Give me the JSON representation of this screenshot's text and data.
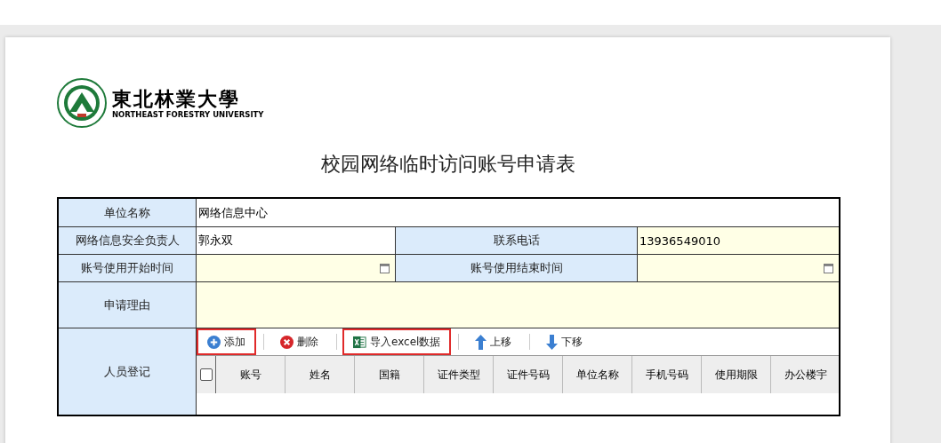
{
  "logo": {
    "name_cn": "東北林業大學",
    "name_en": "NORTHEAST FORESTRY UNIVERSITY"
  },
  "title": "校园网络临时访问账号申请表",
  "form": {
    "unit": {
      "label": "单位名称",
      "value": "网络信息中心",
      "kind": "readonly"
    },
    "manager": {
      "label": "网络信息安全负责人",
      "value": "郭永双",
      "kind": "readonly"
    },
    "phone": {
      "label": "联系电话",
      "value": "13936549010",
      "kind": "input"
    },
    "start": {
      "label": "账号使用开始时间",
      "kind": "date"
    },
    "end": {
      "label": "账号使用结束时间",
      "kind": "date"
    },
    "reason": {
      "label": "申请理由",
      "kind": "input"
    },
    "people": {
      "label": "人员登记",
      "toolbar": [
        {
          "label": "添加",
          "kind": "add",
          "highlighted": true
        },
        {
          "label": "删除",
          "kind": "delete",
          "highlighted": false
        },
        {
          "label": "导入excel数据",
          "kind": "excel",
          "highlighted": true
        },
        {
          "label": "上移",
          "kind": "up",
          "highlighted": false
        },
        {
          "label": "下移",
          "kind": "down",
          "highlighted": false
        }
      ],
      "select_all": {
        "checked": false
      },
      "columns": [
        "账号",
        "姓名",
        "国籍",
        "证件类型",
        "证件号码",
        "单位名称",
        "手机号码",
        "使用期限",
        "办公楼宇"
      ]
    }
  }
}
